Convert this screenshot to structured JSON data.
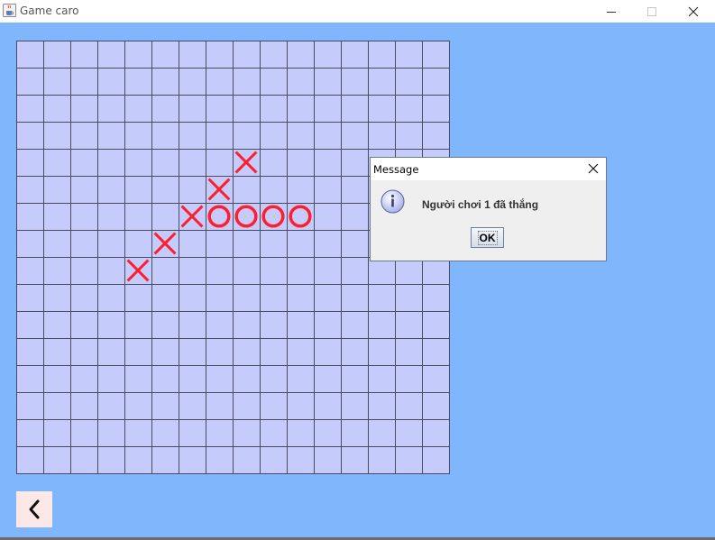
{
  "window": {
    "title": "Game caro",
    "icons": {
      "app": "java-cup-icon",
      "minimize": "minimize-icon",
      "maximize": "maximize-icon",
      "close": "close-icon"
    }
  },
  "colors": {
    "background": "#7fb6fc",
    "board": "#c5ccfc",
    "grid_line": "#4a4a63",
    "mark": "#ff1e2e",
    "back_button": "#fde8e8"
  },
  "board": {
    "columns": 16,
    "rows": 16,
    "moves": [
      {
        "mark": "X",
        "row": 4,
        "col": 8
      },
      {
        "mark": "X",
        "row": 5,
        "col": 7
      },
      {
        "mark": "X",
        "row": 6,
        "col": 6
      },
      {
        "mark": "O",
        "row": 6,
        "col": 7
      },
      {
        "mark": "O",
        "row": 6,
        "col": 8
      },
      {
        "mark": "O",
        "row": 6,
        "col": 9
      },
      {
        "mark": "O",
        "row": 6,
        "col": 10
      },
      {
        "mark": "X",
        "row": 7,
        "col": 5
      },
      {
        "mark": "X",
        "row": 8,
        "col": 4
      }
    ]
  },
  "back_button": {
    "icon": "chevron-left-icon"
  },
  "dialog": {
    "title": "Message",
    "icon": "info-icon",
    "message": "Người chơi 1 đã thắng",
    "ok_label": "OK"
  }
}
